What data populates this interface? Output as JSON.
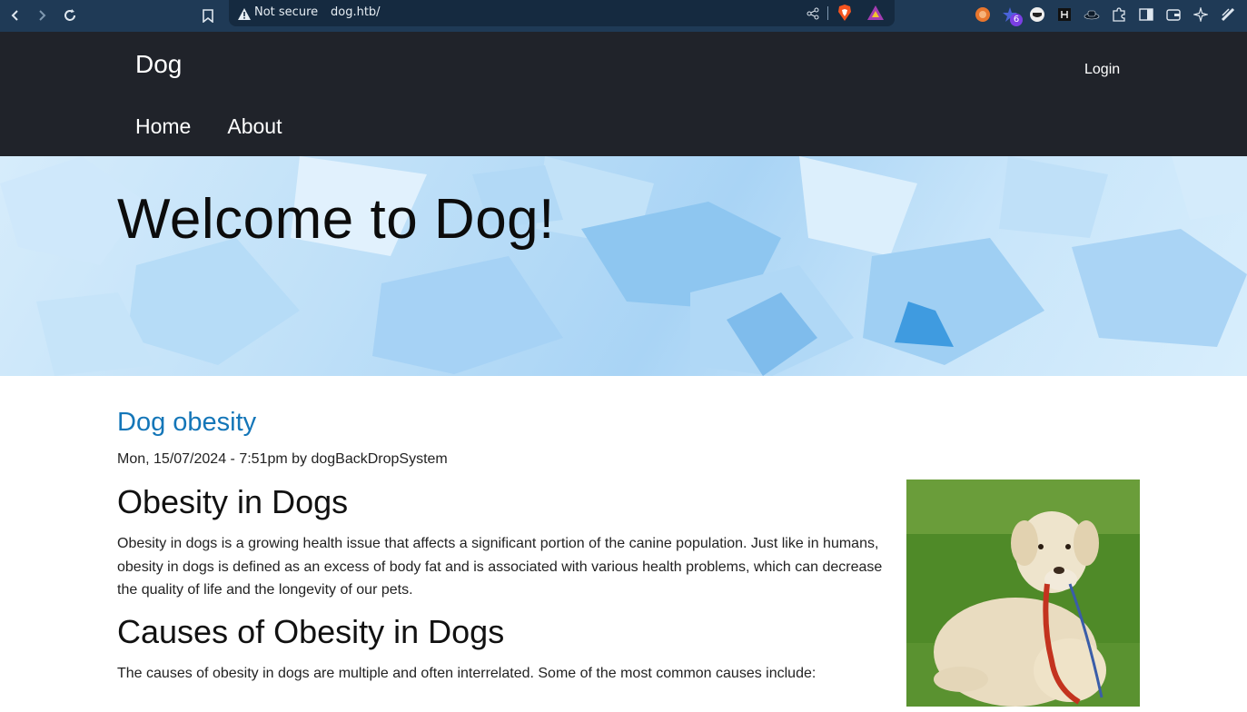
{
  "browser": {
    "security_label": "Not secure",
    "url": "dog.htb/",
    "extension_badge": "6"
  },
  "site": {
    "brand": "Dog",
    "login_label": "Login",
    "menu": [
      {
        "label": "Home"
      },
      {
        "label": "About"
      }
    ],
    "hero_title": "Welcome to Dog!"
  },
  "article": {
    "title": "Dog obesity",
    "meta": "Mon, 15/07/2024 - 7:51pm by dogBackDropSystem",
    "heading1": "Obesity in Dogs",
    "paragraph1": "Obesity in dogs is a growing health issue that affects a significant portion of the canine population. Just like in humans, obesity in dogs is defined as an excess of body fat and is associated with various health problems, which can decrease the quality of life and the longevity of our pets.",
    "heading2": "Causes of Obesity in Dogs",
    "paragraph2": "The causes of obesity in dogs are multiple and often interrelated. Some of the most common causes include:"
  },
  "colors": {
    "header_bg": "#20232a",
    "link": "#1476b8",
    "chrome_bg": "#1f3a56"
  }
}
